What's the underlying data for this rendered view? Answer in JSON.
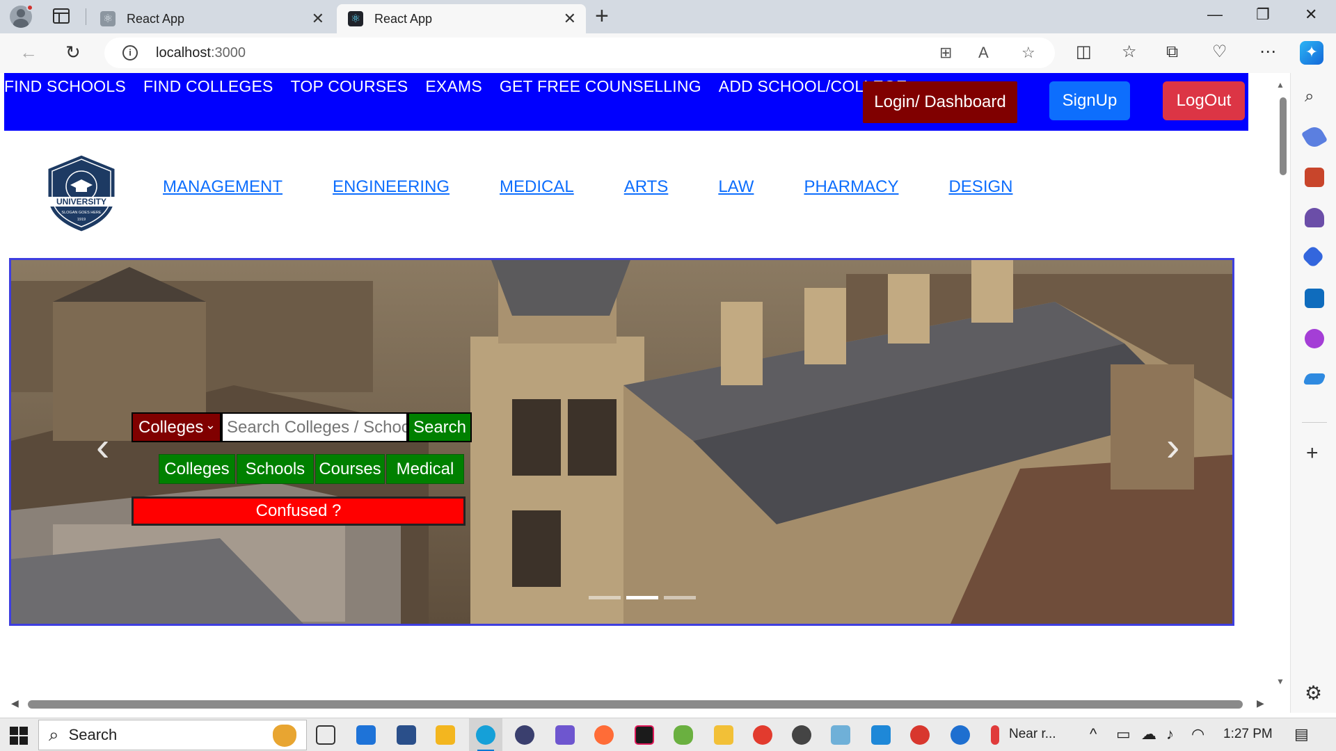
{
  "browser": {
    "tabs": [
      {
        "title": "React App",
        "active": false
      },
      {
        "title": "React App",
        "active": true
      }
    ],
    "url_host": "localhost",
    "url_port": ":3000"
  },
  "topnav": {
    "links": [
      "FIND SCHOOLS",
      "FIND COLLEGES",
      "TOP COURSES",
      "EXAMS",
      "GET FREE COUNSELLING",
      "ADD SCHOOL/COLLEGE"
    ],
    "login_label": "Login/ Dashboard",
    "signup_label": "SignUp",
    "logout_label": "LogOut"
  },
  "logo": {
    "title": "UNIVERSITY",
    "slogan": "SLOGAN GOES HERE",
    "year": "1919"
  },
  "category_nav": [
    "MANAGEMENT",
    "ENGINEERING",
    "MEDICAL",
    "ARTS",
    "LAW",
    "PHARMACY",
    "DESIGN"
  ],
  "hero": {
    "search_type": "Colleges",
    "search_placeholder": "Search Colleges / Schools",
    "search_button": "Search",
    "quick_links": [
      "Colleges",
      "Schools",
      "Courses",
      "Medical"
    ],
    "confused_label": "Confused ?",
    "slides": 3,
    "active_slide": 2
  },
  "taskbar": {
    "search_label": "Search",
    "weather_text": "Near r...",
    "time": "1:27 PM"
  },
  "colors": {
    "nav_bg": "#0000ff",
    "login_bg": "#800000",
    "signup_bg": "#0d6efd",
    "logout_bg": "#dc3545",
    "search_btn_bg": "#008000",
    "confused_bg": "#ff0000"
  }
}
